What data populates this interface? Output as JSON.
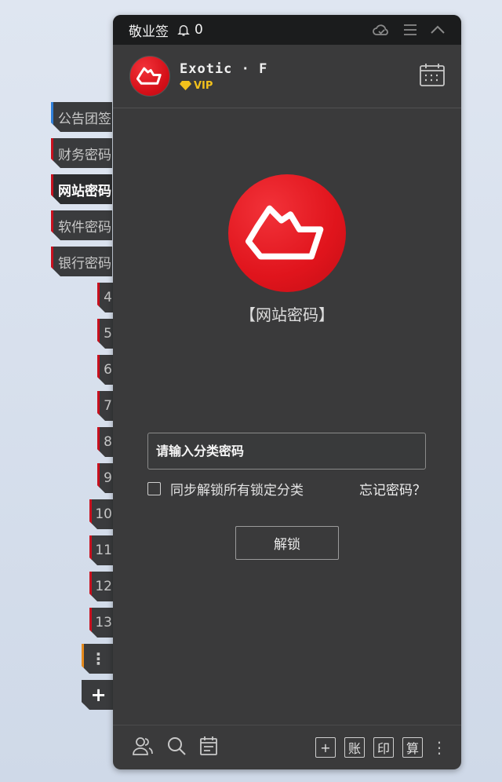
{
  "titlebar": {
    "app_name": "敬业签",
    "notification_count": "0"
  },
  "profile": {
    "username": "Exotic · F",
    "badge": "VIP"
  },
  "sidebar": {
    "categories": [
      {
        "label": "公告团签"
      },
      {
        "label": "财务密码"
      },
      {
        "label": "网站密码"
      },
      {
        "label": "软件密码"
      },
      {
        "label": "银行密码"
      }
    ],
    "numbers": [
      "4",
      "5",
      "6",
      "7",
      "8",
      "9",
      "10",
      "11",
      "12",
      "13"
    ],
    "more": "⋮",
    "add": "+"
  },
  "main": {
    "category_title": "【网站密码】",
    "password_placeholder": "请输入分类密码",
    "sync_label": "同步解锁所有锁定分类",
    "forgot_label": "忘记密码？",
    "unlock_label": "解锁"
  },
  "bottombar": {
    "add_label": "+",
    "account_label": "账",
    "print_label": "印",
    "calc_label": "算",
    "more_label": "⋮"
  },
  "colors": {
    "accent": "#c8101e",
    "brand_red": "#e0141c",
    "vip_gold": "#f2c11c",
    "panel": "#3a3a3b"
  }
}
